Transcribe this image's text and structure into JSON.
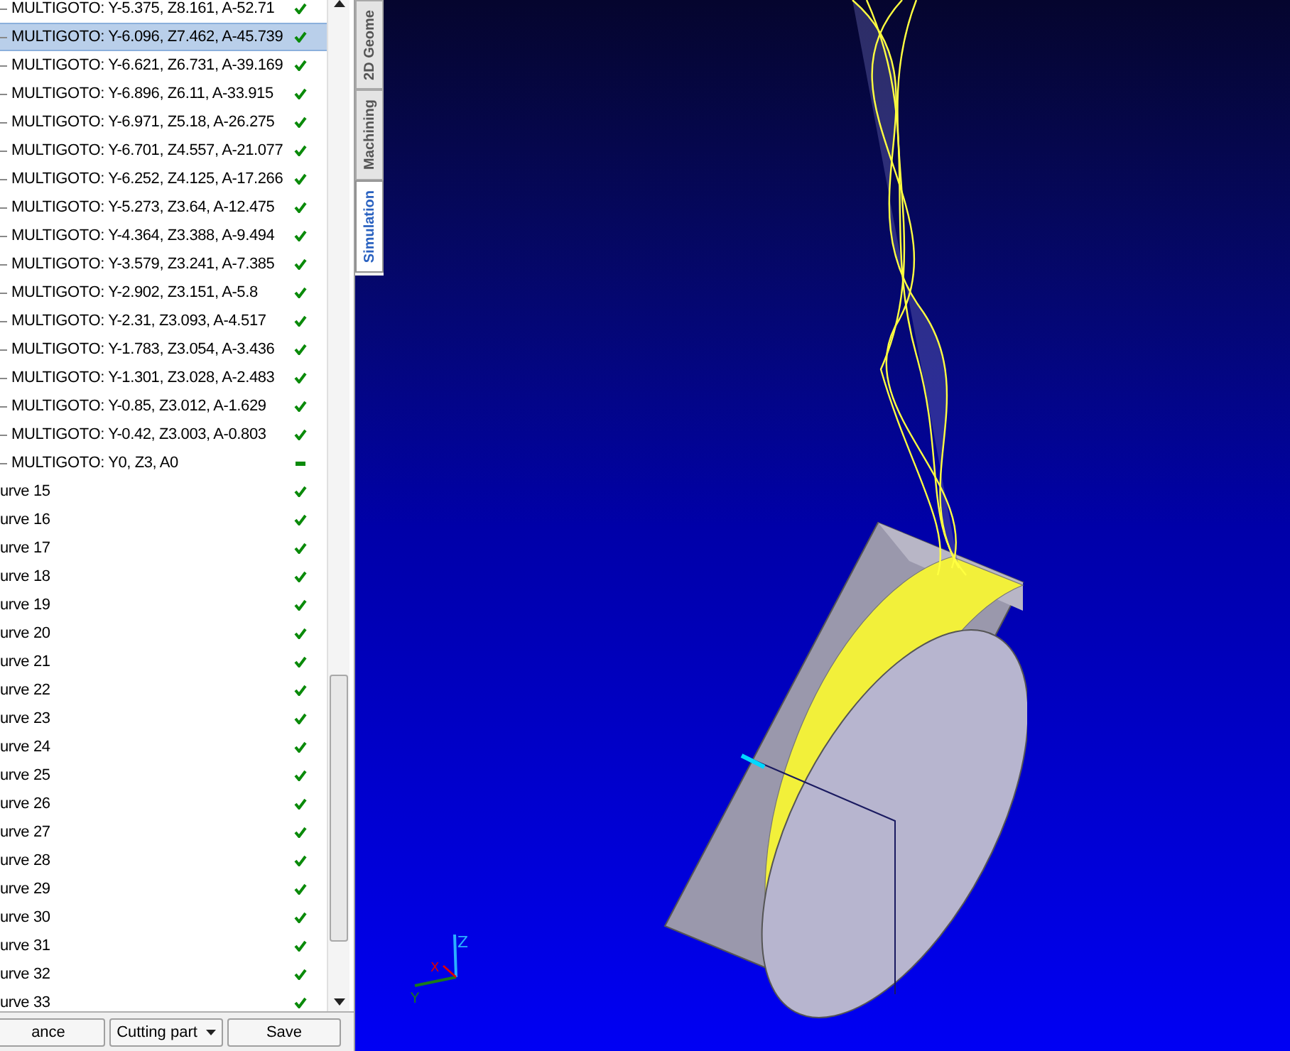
{
  "tree": {
    "rows": [
      {
        "label": "MULTIGOTO: Y-5.375, Z8.161, A-52.71",
        "branch": true,
        "done": true,
        "selected": false
      },
      {
        "label": "MULTIGOTO: Y-6.096, Z7.462, A-45.739",
        "branch": true,
        "done": true,
        "selected": true
      },
      {
        "label": "MULTIGOTO: Y-6.621, Z6.731, A-39.169",
        "branch": true,
        "done": true,
        "selected": false
      },
      {
        "label": "MULTIGOTO: Y-6.896, Z6.11, A-33.915",
        "branch": true,
        "done": true,
        "selected": false
      },
      {
        "label": "MULTIGOTO: Y-6.971, Z5.18, A-26.275",
        "branch": true,
        "done": true,
        "selected": false
      },
      {
        "label": "MULTIGOTO: Y-6.701, Z4.557, A-21.077",
        "branch": true,
        "done": true,
        "selected": false
      },
      {
        "label": "MULTIGOTO: Y-6.252, Z4.125, A-17.266",
        "branch": true,
        "done": true,
        "selected": false
      },
      {
        "label": "MULTIGOTO: Y-5.273, Z3.64, A-12.475",
        "branch": true,
        "done": true,
        "selected": false
      },
      {
        "label": "MULTIGOTO: Y-4.364, Z3.388, A-9.494",
        "branch": true,
        "done": true,
        "selected": false
      },
      {
        "label": "MULTIGOTO: Y-3.579, Z3.241, A-7.385",
        "branch": true,
        "done": true,
        "selected": false
      },
      {
        "label": "MULTIGOTO: Y-2.902, Z3.151, A-5.8",
        "branch": true,
        "done": true,
        "selected": false
      },
      {
        "label": "MULTIGOTO: Y-2.31, Z3.093, A-4.517",
        "branch": true,
        "done": true,
        "selected": false
      },
      {
        "label": "MULTIGOTO: Y-1.783, Z3.054, A-3.436",
        "branch": true,
        "done": true,
        "selected": false
      },
      {
        "label": "MULTIGOTO: Y-1.301, Z3.028, A-2.483",
        "branch": true,
        "done": true,
        "selected": false
      },
      {
        "label": "MULTIGOTO: Y-0.85, Z3.012, A-1.629",
        "branch": true,
        "done": true,
        "selected": false
      },
      {
        "label": "MULTIGOTO: Y-0.42, Z3.003, A-0.803",
        "branch": true,
        "done": true,
        "selected": false
      },
      {
        "label": "MULTIGOTO: Y0, Z3, A0",
        "branch": true,
        "done": false,
        "selected": false
      },
      {
        "label": "urve 15",
        "branch": false,
        "done": true,
        "selected": false
      },
      {
        "label": "urve 16",
        "branch": false,
        "done": true,
        "selected": false
      },
      {
        "label": "urve 17",
        "branch": false,
        "done": true,
        "selected": false
      },
      {
        "label": "urve 18",
        "branch": false,
        "done": true,
        "selected": false
      },
      {
        "label": "urve 19",
        "branch": false,
        "done": true,
        "selected": false
      },
      {
        "label": "urve 20",
        "branch": false,
        "done": true,
        "selected": false
      },
      {
        "label": "urve 21",
        "branch": false,
        "done": true,
        "selected": false
      },
      {
        "label": "urve 22",
        "branch": false,
        "done": true,
        "selected": false
      },
      {
        "label": "urve 23",
        "branch": false,
        "done": true,
        "selected": false
      },
      {
        "label": "urve 24",
        "branch": false,
        "done": true,
        "selected": false
      },
      {
        "label": "urve 25",
        "branch": false,
        "done": true,
        "selected": false
      },
      {
        "label": "urve 26",
        "branch": false,
        "done": true,
        "selected": false
      },
      {
        "label": "urve 27",
        "branch": false,
        "done": true,
        "selected": false
      },
      {
        "label": "urve 28",
        "branch": false,
        "done": true,
        "selected": false
      },
      {
        "label": "urve 29",
        "branch": false,
        "done": true,
        "selected": false
      },
      {
        "label": "urve 30",
        "branch": false,
        "done": true,
        "selected": false
      },
      {
        "label": "urve 31",
        "branch": false,
        "done": true,
        "selected": false
      },
      {
        "label": "urve 32",
        "branch": false,
        "done": true,
        "selected": false
      },
      {
        "label": "urve 33",
        "branch": false,
        "done": true,
        "selected": false
      }
    ]
  },
  "buttons": [
    {
      "label": "ance",
      "kind": "plain"
    },
    {
      "label": "Cutting part",
      "kind": "dropdown"
    },
    {
      "label": "Save",
      "kind": "plain"
    }
  ],
  "side_tabs": [
    {
      "label": "2D Geome",
      "selected": false
    },
    {
      "label": "Machining",
      "selected": false
    },
    {
      "label": "Simulation",
      "selected": true
    }
  ],
  "axes": {
    "z": "Z",
    "x": "X",
    "y": "Y"
  }
}
